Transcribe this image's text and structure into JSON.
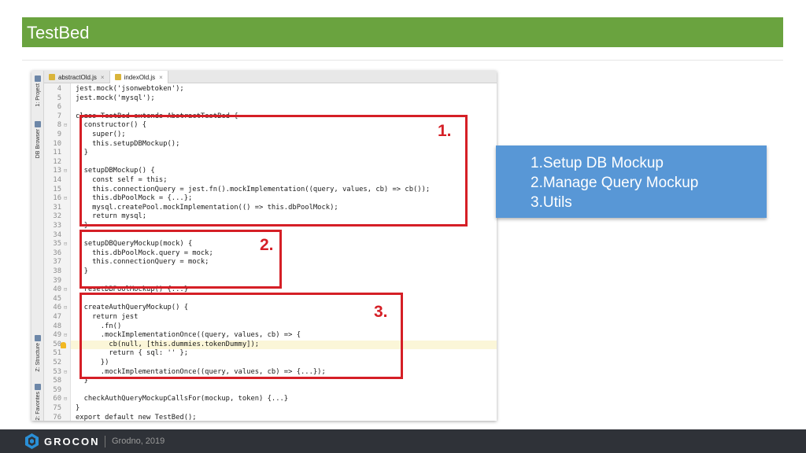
{
  "slide": {
    "title": "TestBed"
  },
  "ide": {
    "tabs": [
      {
        "label": "abstractOld.js",
        "active": false
      },
      {
        "label": "indexOld.js",
        "active": true
      }
    ],
    "side_tabs": [
      "1: Project",
      "DB Browser",
      "Z: Structure",
      "2: Favorites"
    ],
    "code_lines": [
      {
        "ln": "4",
        "code": "jest.mock('jsonwebtoken');"
      },
      {
        "ln": "5",
        "code": "jest.mock('mysql');"
      },
      {
        "ln": "6",
        "code": ""
      },
      {
        "ln": "7",
        "code": "class TestBed extends AbstractTestBed {"
      },
      {
        "ln": "8",
        "code": "  constructor() {"
      },
      {
        "ln": "9",
        "code": "    super();"
      },
      {
        "ln": "10",
        "code": "    this.setupDBMockup();"
      },
      {
        "ln": "11",
        "code": "  }"
      },
      {
        "ln": "12",
        "code": ""
      },
      {
        "ln": "13",
        "code": "  setupDBMockup() {"
      },
      {
        "ln": "14",
        "code": "    const self = this;"
      },
      {
        "ln": "15",
        "code": "    this.connectionQuery = jest.fn().mockImplementation((query, values, cb) => cb());"
      },
      {
        "ln": "16",
        "code": "    this.dbPoolMock = {...};"
      },
      {
        "ln": "31",
        "code": "    mysql.createPool.mockImplementation(() => this.dbPoolMock);"
      },
      {
        "ln": "32",
        "code": "    return mysql;"
      },
      {
        "ln": "33",
        "code": "  }"
      },
      {
        "ln": "34",
        "code": ""
      },
      {
        "ln": "35",
        "code": "  setupDBQueryMockup(mock) {"
      },
      {
        "ln": "36",
        "code": "    this.dbPoolMock.query = mock;"
      },
      {
        "ln": "37",
        "code": "    this.connectionQuery = mock;"
      },
      {
        "ln": "38",
        "code": "  }"
      },
      {
        "ln": "39",
        "code": ""
      },
      {
        "ln": "40",
        "code": "  resetDBPoolMockup() {...}"
      },
      {
        "ln": "45",
        "code": ""
      },
      {
        "ln": "46",
        "code": "  createAuthQueryMockup() {"
      },
      {
        "ln": "47",
        "code": "    return jest"
      },
      {
        "ln": "48",
        "code": "      .fn()"
      },
      {
        "ln": "49",
        "code": "      .mockImplementationOnce((query, values, cb) => {"
      },
      {
        "ln": "50",
        "code": "        cb(null, [this.dummies.tokenDummy]);"
      },
      {
        "ln": "51",
        "code": "        return { sql: '' };"
      },
      {
        "ln": "52",
        "code": "      })"
      },
      {
        "ln": "53",
        "code": "      .mockImplementationOnce((query, values, cb) => {...});"
      },
      {
        "ln": "58",
        "code": "  }"
      },
      {
        "ln": "59",
        "code": ""
      },
      {
        "ln": "60",
        "code": "  checkAuthQueryMockupCallsFor(mockup, token) {...}"
      },
      {
        "ln": "75",
        "code": "}"
      },
      {
        "ln": "76",
        "code": "export default new TestBed();"
      }
    ]
  },
  "annotations": {
    "box1_label": "1.",
    "box2_label": "2.",
    "box3_label": "3."
  },
  "summary": {
    "items": [
      "1.Setup DB Mockup",
      "2.Manage Query Mockup",
      "3.Utils"
    ]
  },
  "footer": {
    "brand": "GROCON",
    "subtitle": "Grodno, 2019"
  },
  "colors": {
    "title_bar": "#6aa33f",
    "annotation_red": "#d51f26",
    "summary_blue": "#5897d6",
    "footer_bg": "#2f3238"
  }
}
